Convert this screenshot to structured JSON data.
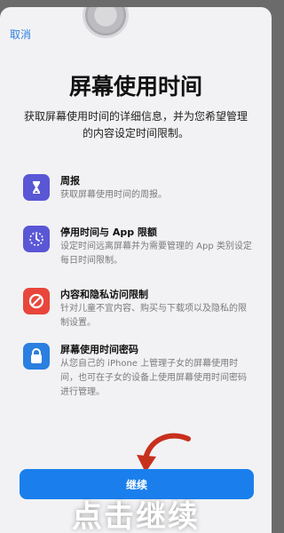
{
  "nav": {
    "cancel_label": "取消"
  },
  "header": {
    "title": "屏幕使用时间",
    "subtitle": "获取屏幕使用时间的详细信息，并为您希望管理的内容设定时间限制。"
  },
  "features": [
    {
      "icon": "hourglass-icon",
      "color": "#5a57d6",
      "title": "周报",
      "desc": "获取屏幕使用时间的周报。"
    },
    {
      "icon": "downtime-icon",
      "color": "#5a57d6",
      "title": "停用时间与 App 限额",
      "desc": "设定时间远离屏幕并为需要管理的 App 类别设定每日时间限制。"
    },
    {
      "icon": "restriction-icon",
      "color": "#e8463c",
      "title": "内容和隐私访问限制",
      "desc": "针对儿童不宜内容、购买与下载项以及隐私的限制设置。"
    },
    {
      "icon": "lock-icon",
      "color": "#2b7fe0",
      "title": "屏幕使用时间密码",
      "desc": "从您自己的 iPhone 上管理子女的屏幕使用时间，也可在子女的设备上使用屏幕使用时间密码进行管理。"
    }
  ],
  "footer": {
    "continue_label": "继续"
  },
  "overlay": {
    "caption": "点击继续"
  }
}
